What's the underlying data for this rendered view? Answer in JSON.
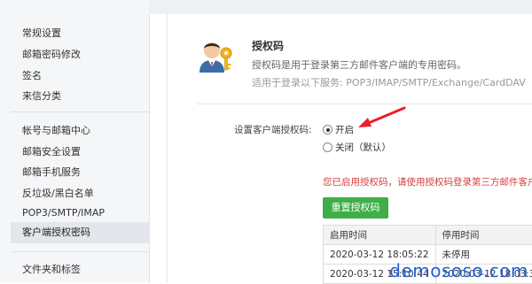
{
  "sidebar": {
    "group1": [
      {
        "label": "常规设置"
      },
      {
        "label": "邮箱密码修改"
      },
      {
        "label": "签名"
      },
      {
        "label": "来信分类"
      }
    ],
    "group2": [
      {
        "label": "帐号与邮箱中心"
      },
      {
        "label": "邮箱安全设置"
      },
      {
        "label": "邮箱手机服务"
      },
      {
        "label": "反垃圾/黑白名单"
      },
      {
        "label": "POP3/SMTP/IMAP"
      },
      {
        "label": "客户端授权密码"
      },
      {
        "label": "文件夹和标签"
      }
    ]
  },
  "header": {
    "title": "授权码",
    "description": "授权码是用于登录第三方邮件客户端的专用密码。",
    "services": "适用于登录以下服务: POP3/IMAP/SMTP/Exchange/CardDAV"
  },
  "setting": {
    "label": "设置客户端授权码:",
    "on_label": "开启",
    "off_label": "关闭（默认）",
    "notice": "您已启用授权码，请使用授权码登录第三方邮件客户端",
    "reset_button": "重置授权码"
  },
  "history": {
    "headers": [
      "启用时间",
      "停用时间"
    ],
    "rows": [
      [
        "2020-03-12 18:05:22",
        "未停用"
      ],
      [
        "2020-03-12 15:10:44",
        "2020-03-12 18:03:31"
      ]
    ]
  },
  "watermark": "demososo.com",
  "colors": {
    "arrow": "#e8202a",
    "button": "#3fae49",
    "notice": "#d43f3a",
    "watermark": "#1f63d8"
  }
}
